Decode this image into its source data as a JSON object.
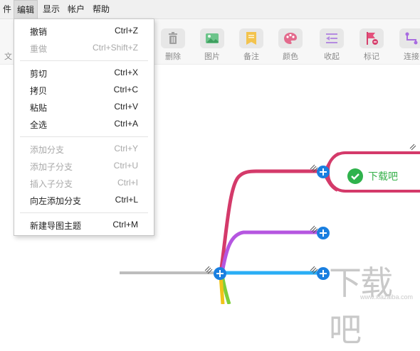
{
  "menubar": {
    "items": [
      "件",
      "编辑",
      "显示",
      "帐户",
      "帮助"
    ]
  },
  "toolbar": {
    "partial_label": "文",
    "buttons": [
      {
        "label": "删除",
        "icon": "trash-icon"
      },
      {
        "label": "图片",
        "icon": "image-icon"
      },
      {
        "label": "备注",
        "icon": "note-icon"
      },
      {
        "label": "颜色",
        "icon": "palette-icon"
      },
      {
        "label": "收起",
        "icon": "collapse-icon"
      },
      {
        "label": "标记",
        "icon": "flag-icon"
      },
      {
        "label": "连接",
        "icon": "connect-icon"
      }
    ]
  },
  "edit_menu": {
    "items": [
      {
        "label": "撤销",
        "shortcut": "Ctrl+Z",
        "enabled": true
      },
      {
        "label": "重做",
        "shortcut": "Ctrl+Shift+Z",
        "enabled": false
      },
      {
        "label": "剪切",
        "shortcut": "Ctrl+X",
        "enabled": true
      },
      {
        "label": "拷贝",
        "shortcut": "Ctrl+C",
        "enabled": true
      },
      {
        "label": "粘贴",
        "shortcut": "Ctrl+V",
        "enabled": true
      },
      {
        "label": "全选",
        "shortcut": "Ctrl+A",
        "enabled": true
      },
      {
        "label": "添加分支",
        "shortcut": "Ctrl+Y",
        "enabled": false
      },
      {
        "label": "添加子分支",
        "shortcut": "Ctrl+U",
        "enabled": false
      },
      {
        "label": "插入子分支",
        "shortcut": "Ctrl+I",
        "enabled": false
      },
      {
        "label": "向左添加分支",
        "shortcut": "Ctrl+L",
        "enabled": true
      },
      {
        "label": "新建导图主题",
        "shortcut": "Ctrl+M",
        "enabled": true
      }
    ]
  },
  "mindmap": {
    "topic_text": "下载吧",
    "branch_colors": {
      "pink": "#d43a6a",
      "purple": "#b556e0",
      "blue": "#2aaef5",
      "green": "#7ccf3a",
      "yellow": "#f0c419",
      "gray": "#bdbdbd"
    }
  },
  "watermark": {
    "text": "下载吧",
    "url": "www.xiazaiba.com"
  },
  "colors": {
    "accent": "#1a7fe0",
    "check": "#2fb24c"
  }
}
